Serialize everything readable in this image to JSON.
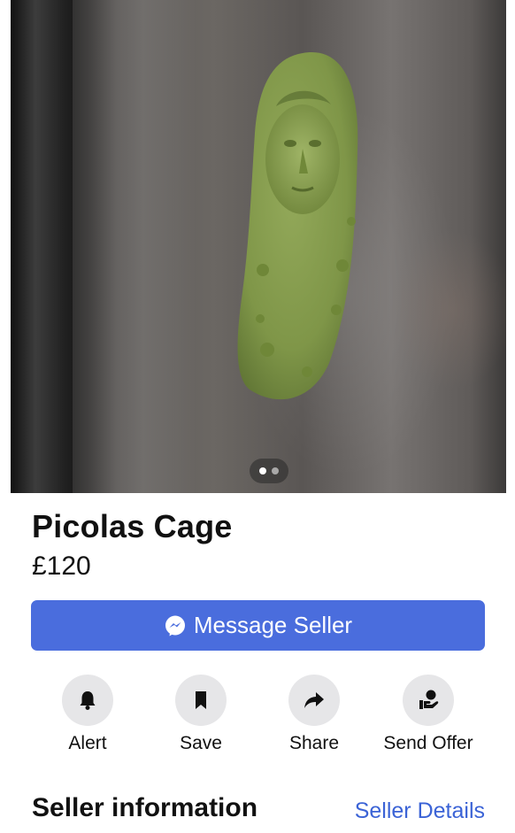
{
  "listing": {
    "title": "Picolas Cage",
    "price": "£120",
    "photo": {
      "count": 2,
      "current": 1
    }
  },
  "primary_action": {
    "label": "Message Seller",
    "icon": "messenger-icon",
    "color": "#4a6ddd"
  },
  "actions": [
    {
      "label": "Alert",
      "icon": "bell-icon"
    },
    {
      "label": "Save",
      "icon": "bookmark-icon"
    },
    {
      "label": "Share",
      "icon": "share-arrow-icon"
    },
    {
      "label": "Send Offer",
      "icon": "offer-hand-icon"
    }
  ],
  "seller": {
    "heading": "Seller information",
    "link_label": "Seller Details",
    "link_color": "#3b63d6"
  }
}
